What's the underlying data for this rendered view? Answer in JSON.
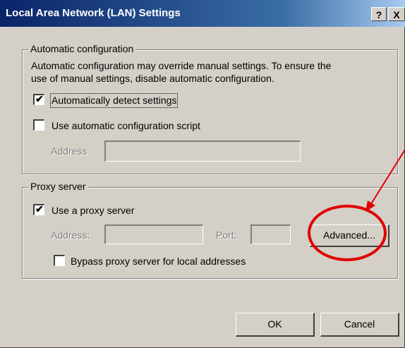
{
  "window": {
    "title": "Local Area Network (LAN) Settings",
    "help_glyph": "?",
    "close_glyph": "X"
  },
  "auto_config": {
    "legend": "Automatic configuration",
    "description_line1": "Automatic configuration may override manual settings.  To ensure the",
    "description_line2": "use of manual settings, disable automatic configuration.",
    "auto_detect_label": "Automatically detect settings",
    "auto_detect_checked": true,
    "use_script_label": "Use automatic configuration script",
    "use_script_checked": false,
    "address_label": "Address",
    "address_value": ""
  },
  "proxy": {
    "legend": "Proxy server",
    "use_proxy_label": "Use a proxy server",
    "use_proxy_checked": true,
    "address_label": "Address:",
    "address_value": "",
    "port_label": "Port:",
    "port_value": "",
    "advanced_label": "Advanced...",
    "bypass_label": "Bypass proxy server for local addresses",
    "bypass_checked": false
  },
  "buttons": {
    "ok": "OK",
    "cancel": "Cancel"
  },
  "check_glyph": "✔",
  "annotation": {
    "color": "#e00000"
  }
}
